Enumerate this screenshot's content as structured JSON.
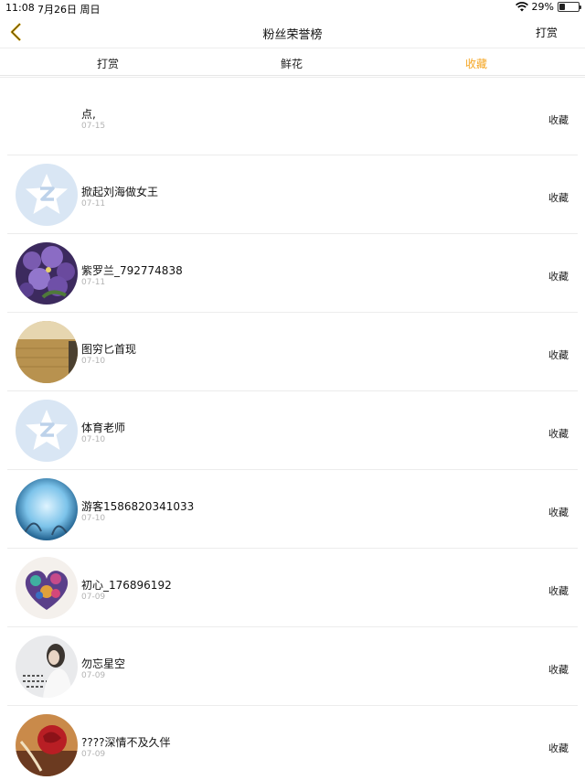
{
  "status_bar": {
    "time": "11:08",
    "date": "7月26日 周日",
    "battery": "29%",
    "battery_level": 0.29
  },
  "nav": {
    "title": "粉丝荣誉榜",
    "right_label": "打赏"
  },
  "tabs": [
    {
      "label": "打赏",
      "active": false
    },
    {
      "label": "鲜花",
      "active": false
    },
    {
      "label": "收藏",
      "active": true
    }
  ],
  "colors": {
    "accent": "#f5a623",
    "divider": "#ececec",
    "muted": "#b3b3b3"
  },
  "rows": [
    {
      "name": "点,",
      "date": "07-15",
      "action": "收藏",
      "avatar": "none"
    },
    {
      "name": "掀起刘海做女王",
      "date": "07-11",
      "action": "收藏",
      "avatar": "default-qq-star"
    },
    {
      "name": "紫罗兰_792774838",
      "date": "07-11",
      "action": "收藏",
      "avatar": "purple-flowers"
    },
    {
      "name": "图穷匕首现",
      "date": "07-10",
      "action": "收藏",
      "avatar": "golden-field"
    },
    {
      "name": "体育老师",
      "date": "07-10",
      "action": "收藏",
      "avatar": "default-qq-star"
    },
    {
      "name": "游客1586820341033",
      "date": "07-10",
      "action": "收藏",
      "avatar": "blue-moon"
    },
    {
      "name": "初心_176896192",
      "date": "07-09",
      "action": "收藏",
      "avatar": "colorful-heart"
    },
    {
      "name": "勿忘星空",
      "date": "07-09",
      "action": "收藏",
      "avatar": "girl-calligraphy"
    },
    {
      "name": "????深情不及久伴",
      "date": "07-09",
      "action": "收藏",
      "avatar": "red-rose"
    }
  ]
}
